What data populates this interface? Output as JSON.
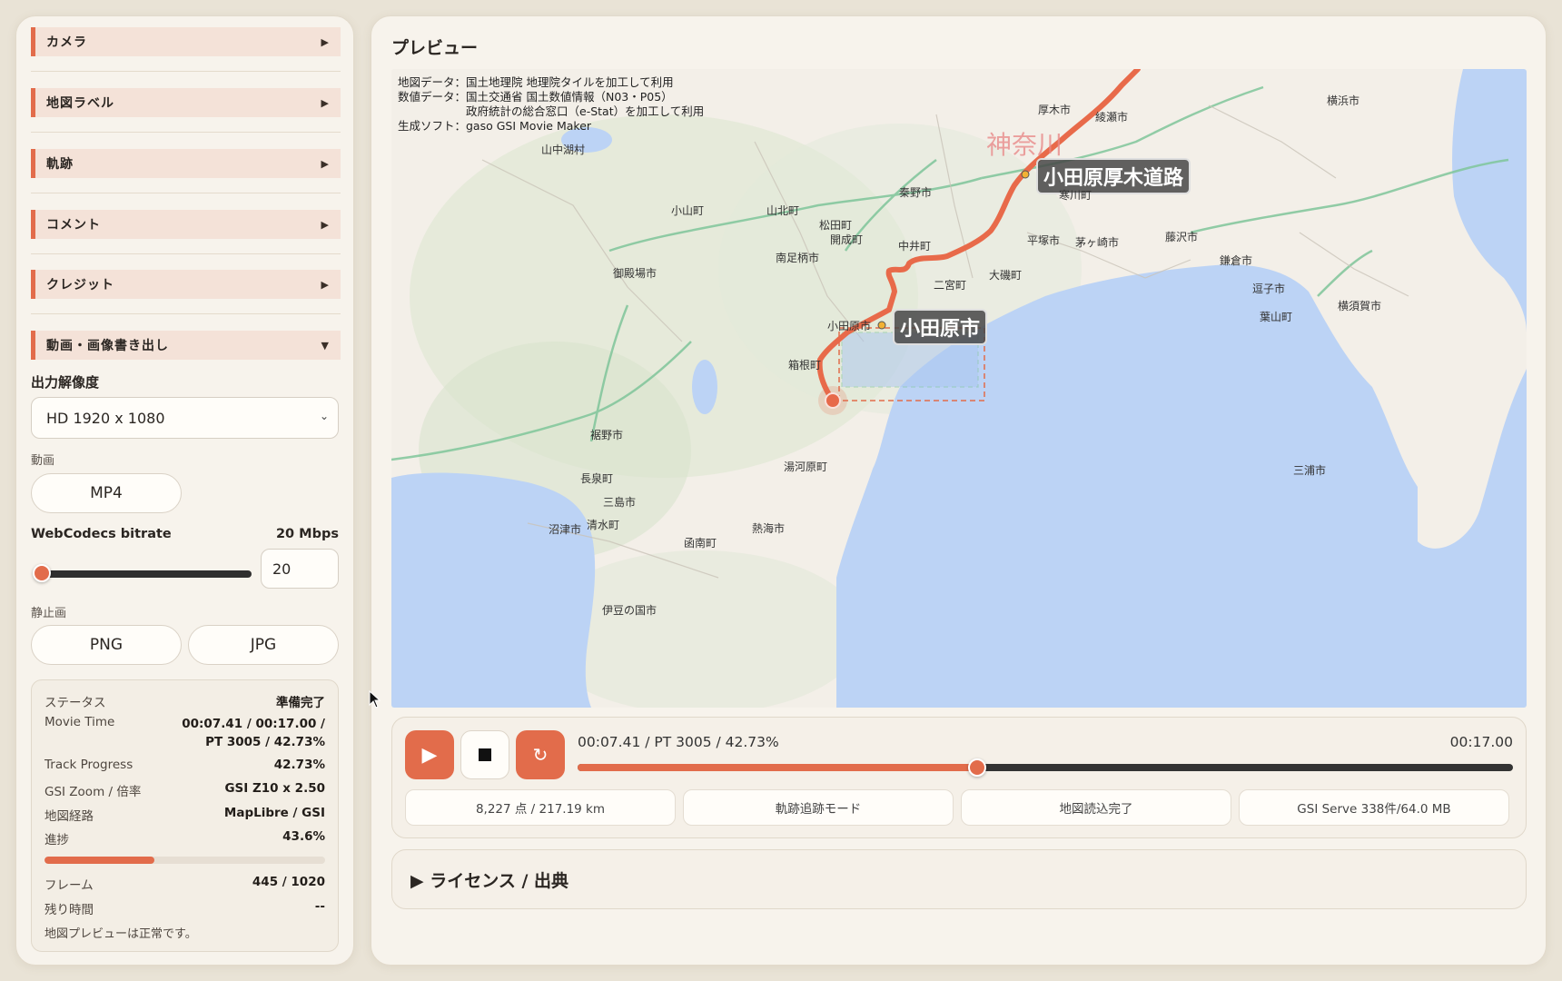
{
  "sidebar": {
    "sections": [
      {
        "label": "カメラ",
        "state": "collapsed"
      },
      {
        "label": "地図ラベル",
        "state": "collapsed"
      },
      {
        "label": "軌跡",
        "state": "collapsed"
      },
      {
        "label": "コメント",
        "state": "collapsed"
      },
      {
        "label": "クレジット",
        "state": "collapsed"
      },
      {
        "label": "動画・画像書き出し",
        "state": "expanded"
      }
    ],
    "export": {
      "resolution_label": "出力解像度",
      "resolution_value": "HD 1920 x 1080",
      "video_label": "動画",
      "video_button": "MP4",
      "bitrate_label": "WebCodecs bitrate",
      "bitrate_display": "20 Mbps",
      "bitrate_input": "20",
      "bitrate_level": 0.0,
      "still_label": "静止画",
      "png_button": "PNG",
      "jpg_button": "JPG"
    },
    "status": {
      "rows": [
        {
          "key": "ステータス",
          "value": "準備完了"
        },
        {
          "key": "Movie Time",
          "value": "00:07.41 / 00:17.00 / PT 3005 / 42.73%"
        },
        {
          "key": "Track Progress",
          "value": "42.73%"
        },
        {
          "key": "GSI Zoom / 倍率",
          "value": "GSI Z10 x 2.50"
        },
        {
          "key": "地図経路",
          "value": "MapLibre / GSI"
        },
        {
          "key": "進捗",
          "value": "43.6%"
        },
        {
          "key": "フレーム",
          "value": "445 / 1020"
        },
        {
          "key": "残り時間",
          "value": "--"
        }
      ],
      "progress_fraction": 0.436,
      "message": "地図プレビューは正常です。"
    }
  },
  "preview": {
    "title": "プレビュー",
    "attribution": "地図データ：国土地理院 地理院タイルを加工して利用\n数値データ：国土交通省 国土数値情報（N03・P05）\n　　　　　　政府統計の総合窓口（e-Stat）を加工して利用\n生成ソフト：gaso GSI Movie Maker",
    "labels": {
      "road_label": "小田原厚木道路",
      "city_label": "小田原市",
      "pref_label": "神奈川",
      "places": [
        "厚木市",
        "綾瀬市",
        "横浜市",
        "山中湖村",
        "秦野市",
        "寒川町",
        "小山町",
        "山北町",
        "松田町",
        "開成町",
        "中井町",
        "平塚市",
        "茅ヶ崎市",
        "藤沢市",
        "南足柄市",
        "二宮町",
        "大磯町",
        "鎌倉市",
        "御殿場市",
        "逗子市",
        "横須賀市",
        "葉山町",
        "小田原市",
        "箱根町",
        "裾野市",
        "湯河原町",
        "長泉町",
        "三島市",
        "清水町",
        "沼津市",
        "函南町",
        "熱海市",
        "伊豆の国市",
        "三浦市"
      ]
    }
  },
  "player": {
    "play_icon": "play-icon",
    "stop_icon": "stop-icon",
    "loop_icon": "loop-icon",
    "time_left": "00:07.41 / PT 3005 / 42.73%",
    "time_right": "00:17.00",
    "progress_fraction": 0.4273,
    "chips": [
      "8,227 点 / 217.19 km",
      "軌跡追跡モード",
      "地図読込完了",
      "GSI Serve 338件/64.0 MB"
    ]
  },
  "license": {
    "label": "▶ ライセンス / 出典"
  },
  "colors": {
    "accent": "#e26c4b",
    "sea": "#bcd3f5",
    "land": "#f3efe8"
  }
}
